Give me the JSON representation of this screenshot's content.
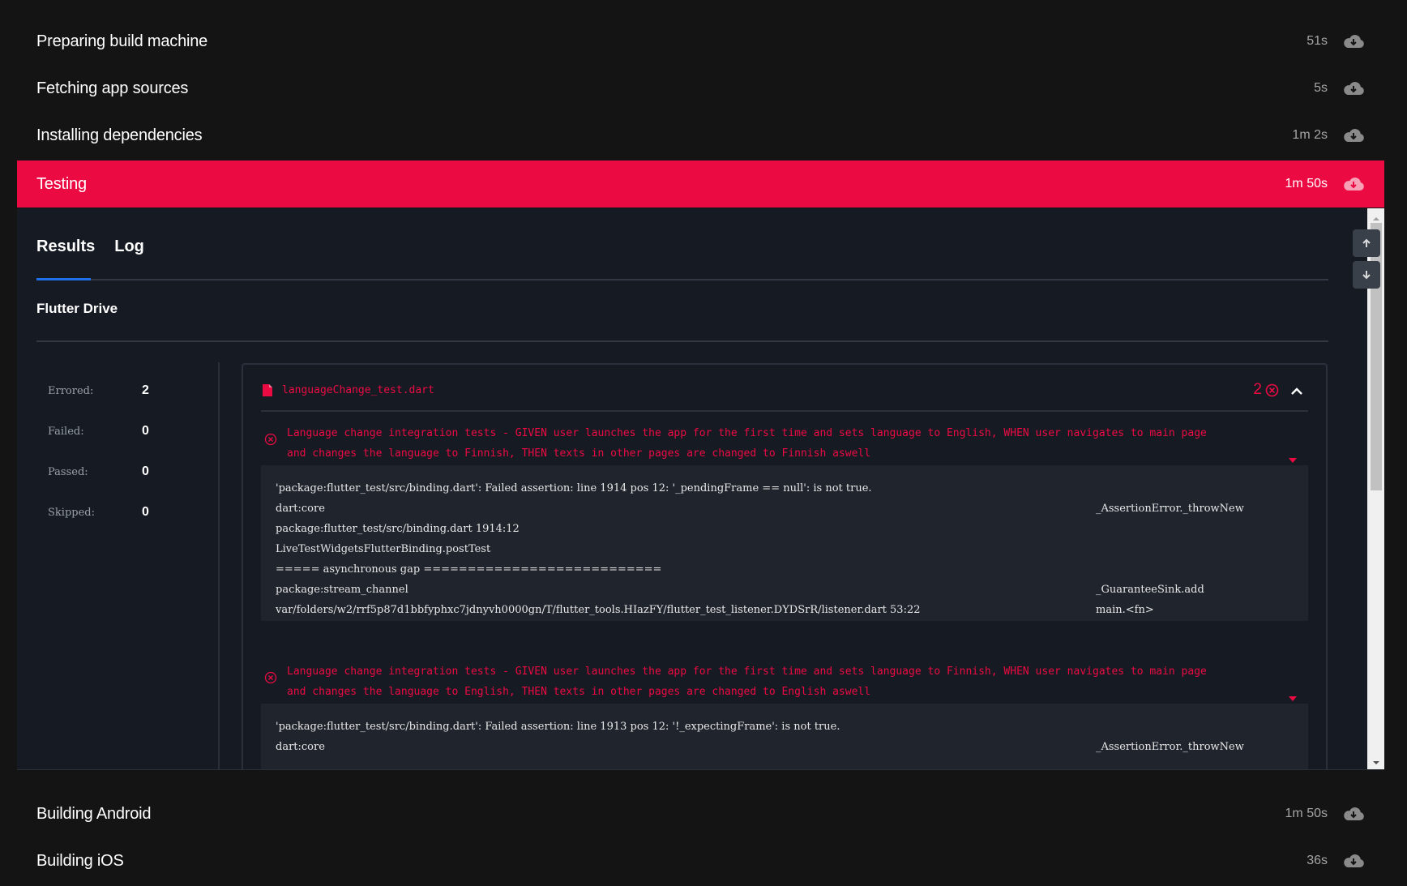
{
  "steps_top": [
    {
      "label": "Preparing build machine",
      "duration": "51s"
    },
    {
      "label": "Fetching app sources",
      "duration": "5s"
    },
    {
      "label": "Installing dependencies",
      "duration": "1m 2s"
    }
  ],
  "active_step": {
    "label": "Testing",
    "duration": "1m 50s"
  },
  "steps_bottom": [
    {
      "label": "Building Android",
      "duration": "1m 50s"
    },
    {
      "label": "Building iOS",
      "duration": "36s"
    }
  ],
  "tabs": [
    {
      "label": "Results"
    },
    {
      "label": "Log"
    }
  ],
  "section_title": "Flutter Drive",
  "stats": [
    {
      "key": "Errored:",
      "value": "2"
    },
    {
      "key": "Failed:",
      "value": "0"
    },
    {
      "key": "Passed:",
      "value": "0"
    },
    {
      "key": "Skipped:",
      "value": "0"
    }
  ],
  "file": {
    "name": "languageChange_test.dart",
    "error_count": "2"
  },
  "tests": [
    {
      "title_line1": "Language change integration tests -  GIVEN user launches the app for the first time and sets language to English, WHEN user navigates to main page",
      "title_line2": "and changes the language to Finnish, THEN texts in other pages are changed to Finnish aswell",
      "trace": [
        {
          "left": "'package:flutter_test/src/binding.dart': Failed assertion: line 1914 pos 12: '_pendingFrame == null': is not true.",
          "right": ""
        },
        {
          "left": "dart:core",
          "right": "_AssertionError._throwNew"
        },
        {
          "left": "package:flutter_test/src/binding.dart 1914:12",
          "right": ""
        },
        {
          "left": "LiveTestWidgetsFlutterBinding.postTest",
          "right": ""
        },
        {
          "left": "===== asynchronous gap ===========================",
          "right": ""
        },
        {
          "left": "package:stream_channel",
          "right": "_GuaranteeSink.add"
        },
        {
          "left": "var/folders/w2/rrf5p87d1bbfyphxc7jdnyvh0000gn/T/flutter_tools.HIazFY/flutter_test_listener.DYDSrR/listener.dart 53:22",
          "right": "main.<fn>"
        }
      ]
    },
    {
      "title_line1": "Language change integration tests -  GIVEN user launches the app for the first time and sets language to Finnish, WHEN user navigates to main page",
      "title_line2": "and changes the language to English, THEN texts in other pages are changed to English aswell",
      "trace": [
        {
          "left": "'package:flutter_test/src/binding.dart': Failed assertion: line 1913 pos 12: '!_expectingFrame': is not true.",
          "right": ""
        },
        {
          "left": "dart:core",
          "right": "_AssertionError._throwNew"
        }
      ]
    }
  ],
  "colors": {
    "accent": "#ec0a43",
    "tab_underline": "#1f6feb",
    "panel_bg": "#161b23",
    "page_bg": "#141414"
  },
  "icons": {
    "download": "cloud-download-icon",
    "file": "file-icon",
    "error": "circle-x-icon",
    "collapse": "chevron-up-icon",
    "scroll_up": "arrow-up-icon",
    "scroll_down": "arrow-down-icon"
  }
}
